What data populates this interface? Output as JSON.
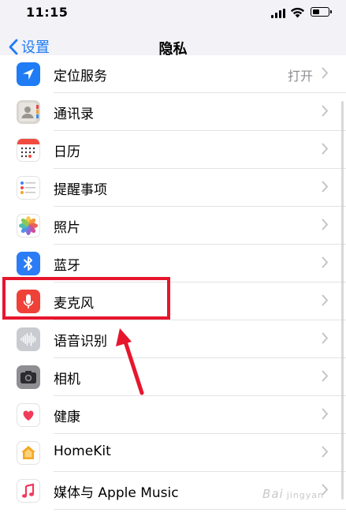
{
  "status_bar": {
    "time": "11:15"
  },
  "nav": {
    "back_label": "设置",
    "title": "隐私"
  },
  "rows": [
    {
      "id": "location",
      "label": "定位服务",
      "value": "打开",
      "icon": "location-icon"
    },
    {
      "id": "contacts",
      "label": "通讯录",
      "icon": "contacts-icon"
    },
    {
      "id": "calendar",
      "label": "日历",
      "icon": "calendar-icon"
    },
    {
      "id": "reminders",
      "label": "提醒事项",
      "icon": "reminders-icon"
    },
    {
      "id": "photos",
      "label": "照片",
      "icon": "photos-icon"
    },
    {
      "id": "bluetooth",
      "label": "蓝牙",
      "icon": "bluetooth-icon"
    },
    {
      "id": "microphone",
      "label": "麦克风",
      "icon": "microphone-icon"
    },
    {
      "id": "speech",
      "label": "语音识别",
      "icon": "waveform-icon"
    },
    {
      "id": "camera",
      "label": "相机",
      "icon": "camera-icon"
    },
    {
      "id": "health",
      "label": "健康",
      "icon": "heart-icon"
    },
    {
      "id": "homekit",
      "label": "HomeKit",
      "icon": "home-icon"
    },
    {
      "id": "media",
      "label": "媒体与 Apple Music",
      "icon": "music-note-icon"
    }
  ],
  "colors": {
    "accent": "#1f7cf5",
    "highlight": "#e6162d",
    "location": "#1f7cf5",
    "bluetooth": "#2c7cf6",
    "microphone": "#ef4137",
    "camera": "#8e8e93",
    "homekit": "#f6a623"
  },
  "watermark": {
    "text": "Bai",
    "suffix": "jingyan"
  }
}
